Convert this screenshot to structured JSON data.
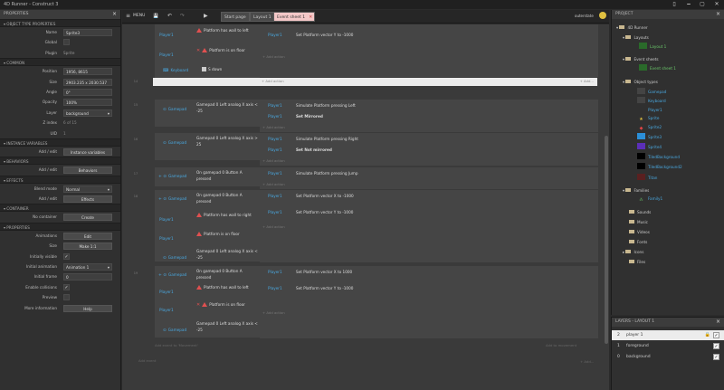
{
  "title": "4D Runner - Construct 3",
  "window_controls": {
    "a": "▯",
    "b": "🗕",
    "c": "▢",
    "d": "✕"
  },
  "properties": {
    "header": "PROPERTIES",
    "sections": {
      "object_type": "OBJECT TYPE PROPERTIES",
      "common": "COMMON",
      "instance_vars": "INSTANCE VARIABLES",
      "behaviors": "BEHAVIORS",
      "effects": "EFFECTS",
      "container": "CONTAINER",
      "props": "PROPERTIES"
    },
    "name_label": "Name",
    "name_value": "Sprite3",
    "global_label": "Global",
    "plugin_label": "Plugin",
    "plugin_value": "Sprite",
    "position_label": "Position",
    "position_value": "1956, 8615",
    "size_label": "Size",
    "size_value": "2903.235 x 2030.537",
    "angle_label": "Angle",
    "angle_value": "0°",
    "opacity_label": "Opacity",
    "opacity_value": "100%",
    "layer_label": "Layer",
    "layer_value": "background",
    "zindex_label": "Z index",
    "zindex_value": "6 of 15",
    "uid_label": "UID",
    "uid_value": "1",
    "iv_label": "Add / edit",
    "iv_btn": "Instance variables",
    "beh_label": "Add / edit",
    "beh_btn": "Behaviors",
    "blend_label": "Blend mode",
    "blend_value": "Normal",
    "eff_label": "Add / edit",
    "eff_btn": "Effects",
    "cont_label": "No container",
    "cont_btn": "Create",
    "anim_label": "Animations",
    "anim_btn": "Edit",
    "size2_label": "Size",
    "size2_btn": "Make 1:1",
    "vis_label": "Initially visible",
    "ianim_label": "Initial animation",
    "ianim_value": "Animation 1",
    "iframe_label": "Initial frame",
    "iframe_value": "0",
    "coll_label": "Enable collisions",
    "preview_label": "Preview",
    "more_label": "More information",
    "more_btn": "Help"
  },
  "toolbar": {
    "menu": "MENU",
    "save": "💾",
    "undo": "↶",
    "redo": "↷",
    "play": "▶"
  },
  "tabs": [
    "Start page",
    "Layout 1",
    "Event sheet 1"
  ],
  "tab_close": "✕",
  "user": "outerstate",
  "events": {
    "rows": [
      "",
      "",
      "",
      "14",
      "",
      "15",
      "",
      "16",
      "",
      "17",
      "",
      "18",
      "",
      "19"
    ],
    "r_player": "Player1",
    "r_keyboard": "Keyboard",
    "r_gamepad": "Gamepad",
    "c_wall_left": "Platform has wall to left",
    "c_on_floor": "Platform is on floor",
    "c_sdown": "S down",
    "c_gp_left": "Gamepad 0 Left analog X axis < -25",
    "c_gp_right": "Gamepad 0 Left analog X axis > 25",
    "c_gp_a": "On gamepad 0 Button A pressed",
    "c_wall_right": "Platform has wall to right",
    "c_gp_left2": "Gamepad 0 Left analog X axis < -25",
    "a_vecy": "Set  Platform vector Y to -1000",
    "a_sim_left": "Simulate  Platform pressing Left",
    "a_mirrored": "Set Mirrored",
    "a_sim_right": "Simulate  Platform pressing Right",
    "a_notmirrored": "Set Not mirrored",
    "a_sim_jump": "Simulate  Platform pressing Jump",
    "a_vecx": "Set  Platform vector X to -1000",
    "a_vecy2": "Set  Platform vector Y to -1000",
    "a_vecx2": "Set  Platform vector X to 1000",
    "add_action": "+ Add action",
    "add_action2": "+ Add action",
    "add_event_to": "Add event to 'Movement'",
    "add_to_movement": "Add to movement",
    "add_event": "Add event",
    "add_right": "+ Add..."
  },
  "project": {
    "header": "PROJECT",
    "root": "4D Runner",
    "layouts": "Layouts",
    "layout1": "Layout 1",
    "eventsheets": "Event sheets",
    "eventsheet1": "Event sheet 1",
    "objtypes": "Object types",
    "objs": [
      "Gamepad",
      "Keyboard",
      "Player1",
      "Sprite",
      "Sprite2",
      "Sprite3",
      "Sprite4",
      "TiledBackground",
      "TiledBackground2",
      "Titan"
    ],
    "families": "Families",
    "family1": "Family1",
    "sounds": "Sounds",
    "music": "Music",
    "videos": "Videos",
    "fonts": "Fonts",
    "icons": "Icons",
    "files": "Files"
  },
  "layers": {
    "header": "LAYERS - LAYOUT 1",
    "items": [
      {
        "num": "2",
        "name": "player 1"
      },
      {
        "num": "1",
        "name": "foreground"
      },
      {
        "num": "0",
        "name": "background"
      }
    ],
    "check": "✓",
    "lock": "🔒"
  }
}
